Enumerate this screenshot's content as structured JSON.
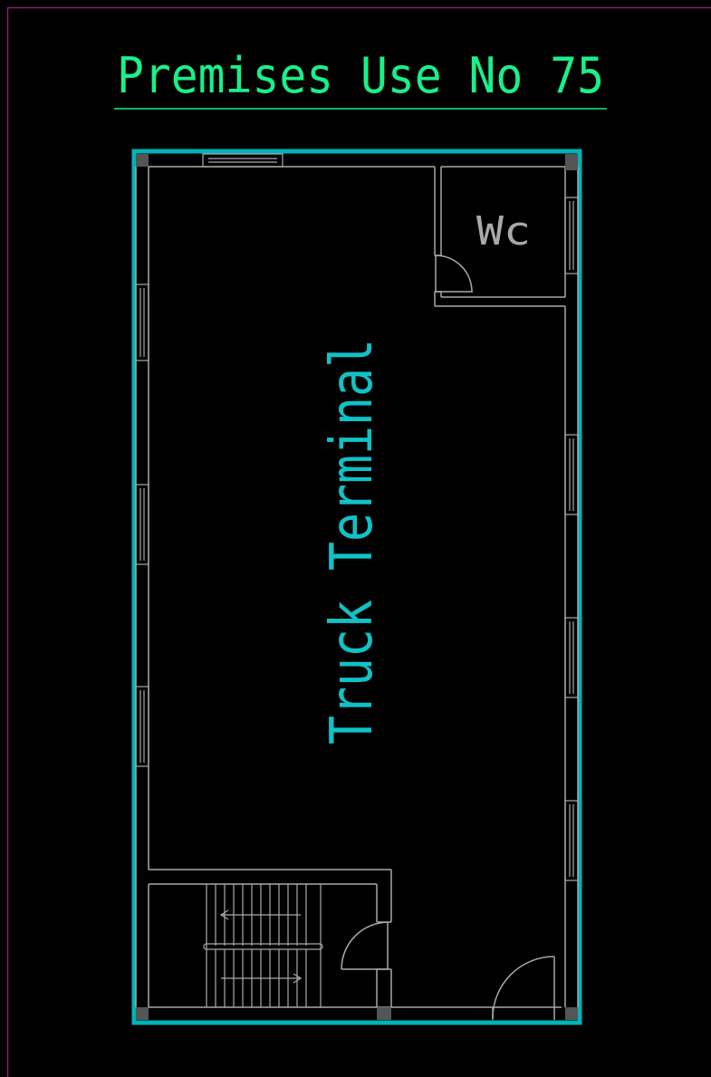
{
  "title": "Premises Use No 75",
  "rooms": {
    "main": "Truck Terminal",
    "wc": "Wc"
  },
  "colors": {
    "background": "#000000",
    "sheet_border": "#8b1a6b",
    "title": "#19f08a",
    "boundary": "#00b3b8",
    "walls": "#a9a9a9",
    "label_main": "#10c2c6",
    "label_wc": "#a9a9a9",
    "columns": "#555555"
  }
}
